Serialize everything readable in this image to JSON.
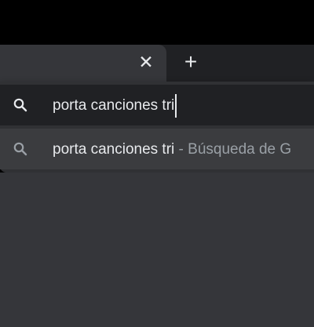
{
  "tab": {
    "close_icon": "close-icon",
    "close_glyph": "✕",
    "new_tab_icon": "plus-icon",
    "new_tab_glyph": "+"
  },
  "omnibox": {
    "input_value": "porta canciones tri",
    "search_icon": "search-icon",
    "suggestions": [
      {
        "query": "porta canciones tri",
        "separator": " - ",
        "hint": "Búsqueda de G"
      }
    ]
  },
  "colors": {
    "background": "#000000",
    "tabstrip": "#202124",
    "tab_active": "#35363a",
    "dropdown": "#303134",
    "suggestion_highlight": "#3b3c3f",
    "text_primary": "#e8eaed",
    "text_secondary": "#9aa0a6"
  }
}
